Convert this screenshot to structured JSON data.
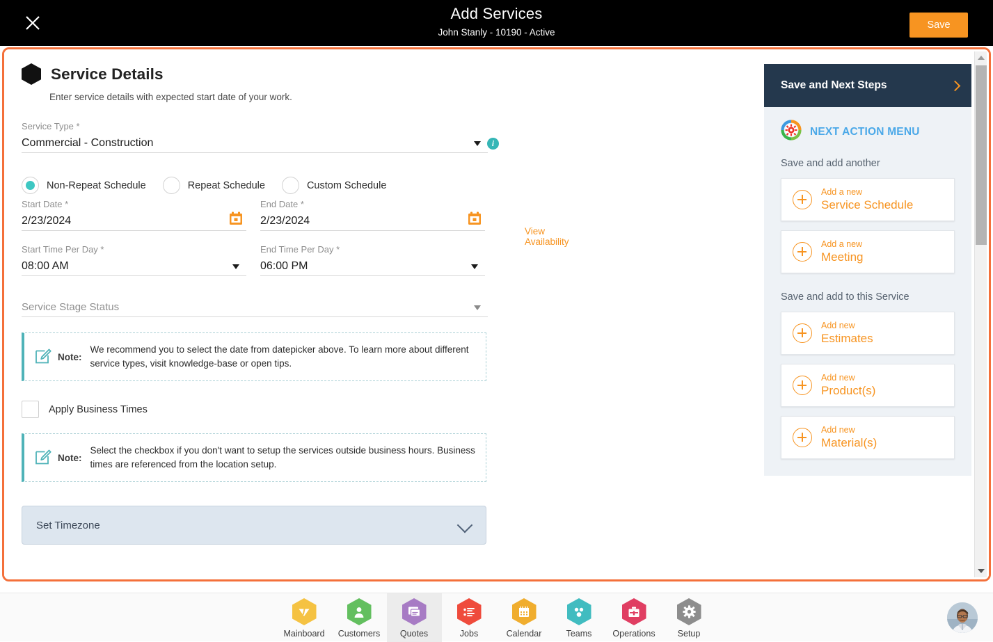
{
  "topbar": {
    "close_icon": "close-icon",
    "title": "Add Services",
    "subtitle": "John Stanly - 10190 - Active",
    "save_label": "Save"
  },
  "colors": {
    "accent_orange": "#f79421",
    "frame_orange": "#f4703a",
    "teal": "#3ec7c2",
    "dark_navy": "#24384d",
    "link_blue": "#4aa8e8"
  },
  "section": {
    "icon": "hexagon-icon",
    "title": "Service Details",
    "subtitle": "Enter service details with expected start date of your work."
  },
  "form": {
    "service_type": {
      "label": "Service Type *",
      "value": "Commercial - Construction",
      "dropdown_icon": "chevron-down-icon",
      "info_icon": "info-icon",
      "info_glyph": "i"
    },
    "schedule_options": [
      {
        "label": "Non-Repeat Schedule",
        "selected": true
      },
      {
        "label": "Repeat Schedule",
        "selected": false
      },
      {
        "label": "Custom Schedule",
        "selected": false
      }
    ],
    "start_date": {
      "label": "Start Date *",
      "value": "2/23/2024",
      "icon": "calendar-icon"
    },
    "end_date": {
      "label": "End Date *",
      "value": "2/23/2024",
      "icon": "calendar-icon"
    },
    "start_time": {
      "label": "Start Time Per Day *",
      "value": "08:00 AM",
      "icon": "chevron-down-icon"
    },
    "end_time": {
      "label": "End Time Per Day *",
      "value": "06:00 PM",
      "icon": "chevron-down-icon"
    },
    "view_availability": "View Availability",
    "service_stage_status": {
      "label": "Service Stage Status",
      "value": "",
      "icon": "chevron-down-icon"
    },
    "note_word": "Note:",
    "note_icon": "edit-note-icon",
    "note_1": "We recommend you to select the date from datepicker above. To learn more about different service types, visit knowledge-base or open tips.",
    "apply_business_times": {
      "label": "Apply Business Times",
      "checked": false
    },
    "note_2": "Select the checkbox if you don't want to setup the services outside business hours. Business times are referenced from the location setup.",
    "set_timezone": {
      "label": "Set Timezone",
      "icon": "chevron-down-icon"
    }
  },
  "right_panel": {
    "header_title": "Save and Next Steps",
    "header_icon": "chevron-right-icon",
    "menu_icon": "gear-refresh-icon",
    "menu_title": "NEXT ACTION MENU",
    "group_1_label": "Save and add another",
    "group_1_items": [
      {
        "top": "Add a new",
        "main": "Service Schedule",
        "icon": "plus-circle-icon"
      },
      {
        "top": "Add a new",
        "main": "Meeting",
        "icon": "plus-circle-icon"
      }
    ],
    "group_2_label": "Save and add to this Service",
    "group_2_items": [
      {
        "top": "Add new",
        "main": "Estimates",
        "icon": "plus-circle-icon"
      },
      {
        "top": "Add new",
        "main": "Product(s)",
        "icon": "plus-circle-icon"
      },
      {
        "top": "Add new",
        "main": "Material(s)",
        "icon": "plus-circle-icon"
      }
    ]
  },
  "scrollbar": {
    "up_icon": "scroll-up-arrow-icon",
    "down_icon": "scroll-down-arrow-icon"
  },
  "bottom_nav": {
    "items": [
      {
        "label": "Mainboard",
        "icon": "mainboard-icon",
        "color": "#f5c242",
        "active": false
      },
      {
        "label": "Customers",
        "icon": "customers-icon",
        "color": "#63bf5f",
        "active": false
      },
      {
        "label": "Quotes",
        "icon": "quotes-icon",
        "color": "#a77bc4",
        "active": true
      },
      {
        "label": "Jobs",
        "icon": "jobs-icon",
        "color": "#ef4b3c",
        "active": false
      },
      {
        "label": "Calendar",
        "icon": "calendar-icon",
        "color": "#f0ad2e",
        "active": false
      },
      {
        "label": "Teams",
        "icon": "teams-icon",
        "color": "#41bcc0",
        "active": false
      },
      {
        "label": "Operations",
        "icon": "operations-icon",
        "color": "#e03e62",
        "active": false
      },
      {
        "label": "Setup",
        "icon": "setup-icon",
        "color": "#8d8d8d",
        "active": false
      }
    ],
    "avatar": "user-avatar"
  }
}
